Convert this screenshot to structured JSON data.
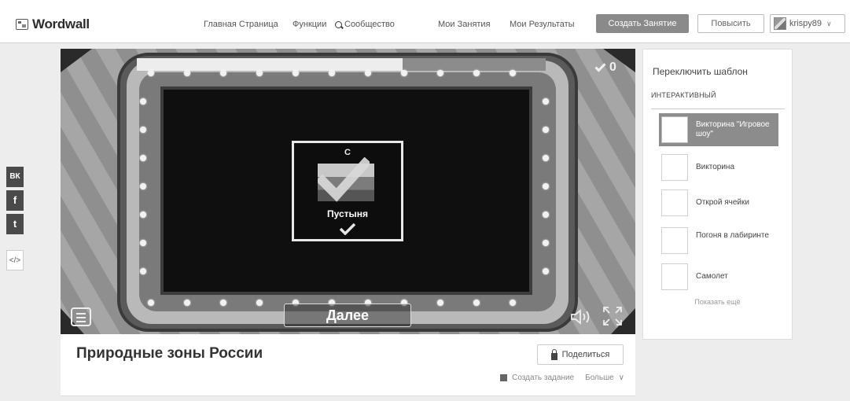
{
  "header": {
    "logo": "Wordwall",
    "nav": [
      {
        "label": "Главная Страница",
        "icon": ""
      },
      {
        "label": "Функции",
        "icon": ""
      },
      {
        "label": "Сообщество",
        "icon": "search-icon"
      },
      {
        "label": "Мои Занятия",
        "icon": ""
      },
      {
        "label": "Мои Результаты",
        "icon": ""
      }
    ],
    "create_label": "Создать Занятие",
    "upgrade_label": "Повысить",
    "username": "krispy89"
  },
  "share": [
    "ВК",
    "f",
    "t",
    "</>"
  ],
  "game": {
    "score": "0",
    "progress": 0.65,
    "card_letter": "С",
    "card_word": "Пустыня",
    "next_label": "Далее"
  },
  "activity": {
    "title": "Природные зоны России",
    "share_label": "Поделиться",
    "meta_left": "Создать задание",
    "meta_right": "Больше"
  },
  "sidebar": {
    "title": "Переключить шаблон",
    "section": "ИНТЕРАКТИВНЫЙ",
    "templates": [
      {
        "label": "Викторина \"Игровое шоу\"",
        "active": true
      },
      {
        "label": "Викторина",
        "active": false
      },
      {
        "label": "Открой ячейки",
        "active": false
      },
      {
        "label": "Погоня в лабиринте",
        "active": false
      },
      {
        "label": "Самолет",
        "active": false
      }
    ],
    "show_more": "Показать ещё"
  }
}
